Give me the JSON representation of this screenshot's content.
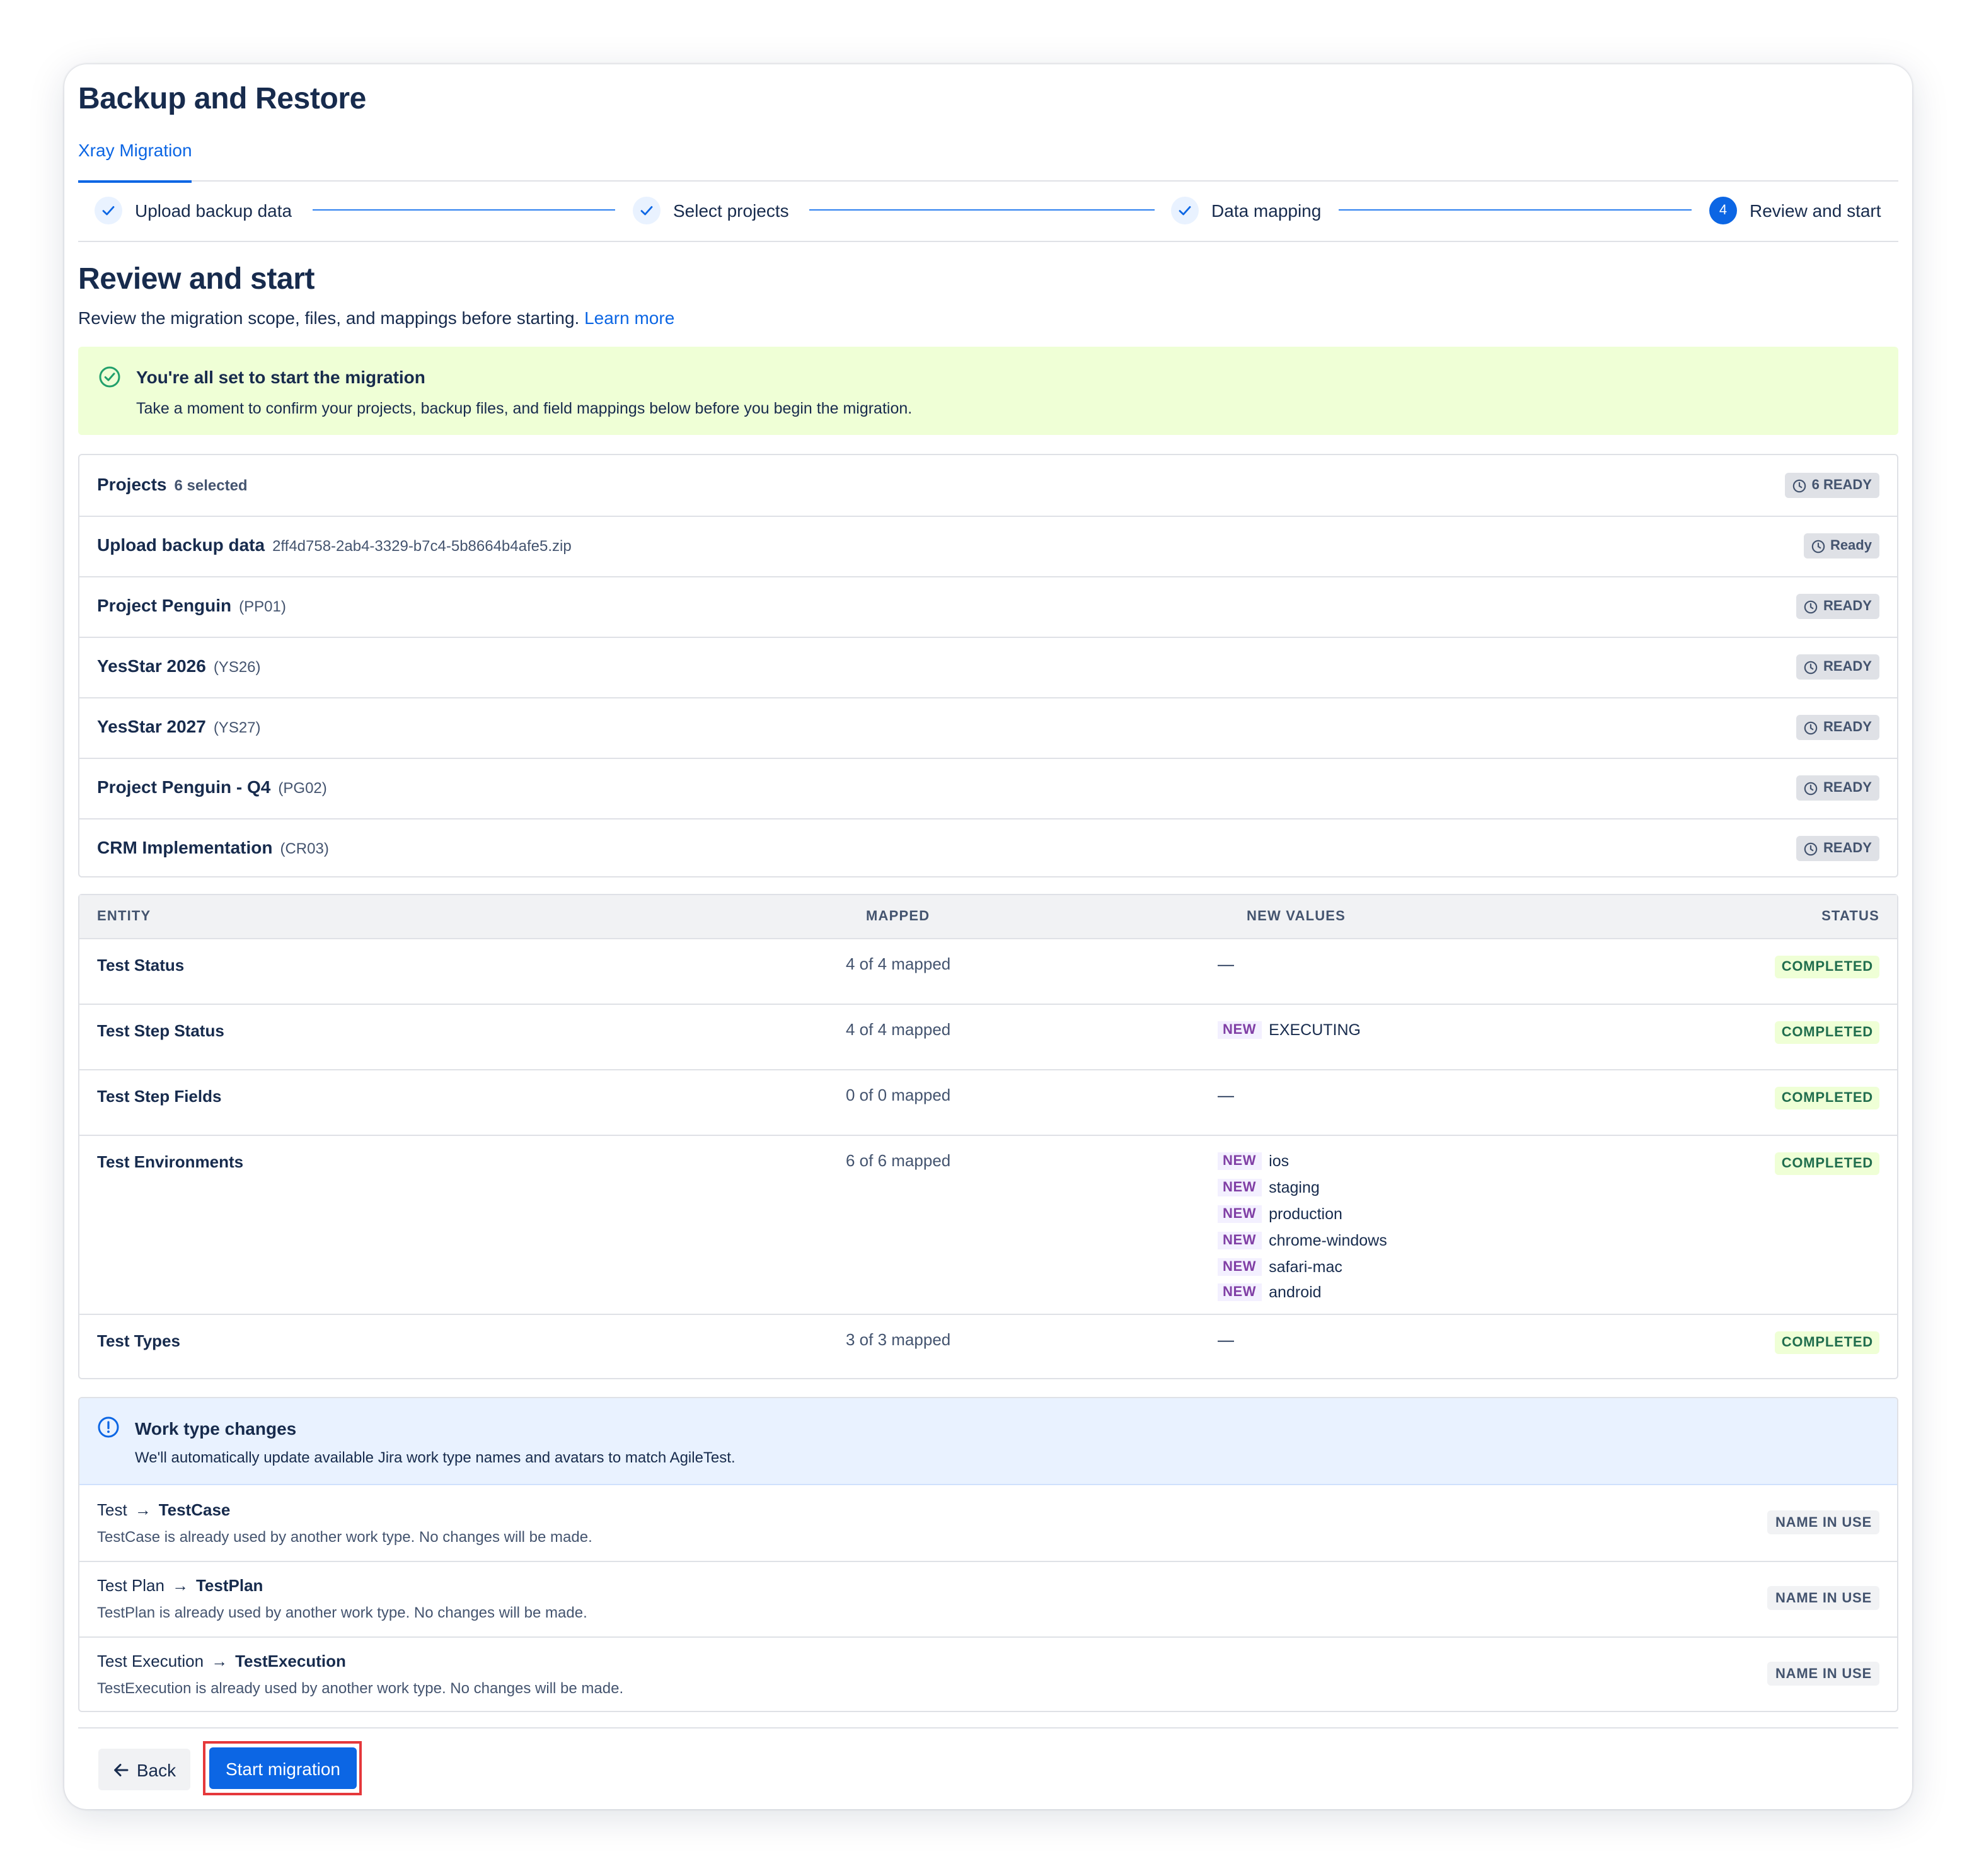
{
  "page": {
    "title": "Backup and Restore",
    "tab": "Xray Migration"
  },
  "stepper": {
    "steps": [
      {
        "label": "Upload backup data",
        "state": "done",
        "icon": "check-icon"
      },
      {
        "label": "Select projects",
        "state": "done",
        "icon": "check-icon"
      },
      {
        "label": "Data mapping",
        "state": "done",
        "icon": "check-icon"
      },
      {
        "label": "Review and start",
        "state": "current",
        "number": "4"
      }
    ]
  },
  "review": {
    "heading": "Review and start",
    "subtitle": "Review the migration scope, files, and mappings before starting.",
    "learn_more": "Learn more"
  },
  "success_banner": {
    "icon": "check-circle-icon",
    "title": "You're all set to start the migration",
    "description": "Take a moment to confirm your projects, backup files, and field mappings below before you begin the migration."
  },
  "projects_panel": {
    "title": "Projects",
    "selected": "6 selected",
    "ready_badge": "6 READY",
    "backup": {
      "label": "Upload backup data",
      "file": "2ff4d758-2ab4-3329-b7c4-5b8664b4afe5.zip",
      "status": "Ready"
    },
    "projects": [
      {
        "name": "Project Penguin",
        "key": "(PP01)",
        "status": "READY"
      },
      {
        "name": "YesStar 2026",
        "key": "(YS26)",
        "status": "READY"
      },
      {
        "name": "YesStar 2027",
        "key": "(YS27)",
        "status": "READY"
      },
      {
        "name": "Project Penguin - Q4",
        "key": "(PG02)",
        "status": "READY"
      },
      {
        "name": "CRM Implementation",
        "key": "(CR03)",
        "status": "READY"
      }
    ]
  },
  "mapping_table": {
    "columns": [
      "ENTITY",
      "MAPPED",
      "NEW VALUES",
      "STATUS"
    ],
    "new_tag": "NEW",
    "empty_value": "—",
    "rows": [
      {
        "entity": "Test Status",
        "mapped": "4 of 4 mapped",
        "new_values": [],
        "status": "COMPLETED"
      },
      {
        "entity": "Test Step Status",
        "mapped": "4 of 4 mapped",
        "new_values": [
          "EXECUTING"
        ],
        "status": "COMPLETED"
      },
      {
        "entity": "Test Step Fields",
        "mapped": "0 of 0 mapped",
        "new_values": [],
        "status": "COMPLETED"
      },
      {
        "entity": "Test Environments",
        "mapped": "6 of 6 mapped",
        "new_values": [
          "ios",
          "staging",
          "production",
          "chrome-windows",
          "safari-mac",
          "android"
        ],
        "status": "COMPLETED"
      },
      {
        "entity": "Test Types",
        "mapped": "3 of 3 mapped",
        "new_values": [],
        "status": "COMPLETED"
      }
    ]
  },
  "work_type": {
    "icon": "info-icon",
    "title": "Work type changes",
    "description": "We'll automatically update available Jira work type names and avatars to match AgileTest.",
    "items": [
      {
        "from": "Test",
        "to": "TestCase",
        "note": "TestCase is already used by another work type. No changes will be made.",
        "status": "NAME IN USE"
      },
      {
        "from": "Test Plan",
        "to": "TestPlan",
        "note": "TestPlan is already used by another work type. No changes will be made.",
        "status": "NAME IN USE"
      },
      {
        "from": "Test Execution",
        "to": "TestExecution",
        "note": "TestExecution is already used by another work type. No changes will be made.",
        "status": "NAME IN USE"
      }
    ]
  },
  "actions": {
    "back": "Back",
    "start": "Start migration"
  },
  "colors": {
    "accent": "#0c66e4",
    "success_bg": "#efffd6",
    "success_text": "#216e4e",
    "new_tag": "#803fa5",
    "highlight": "#e5383b"
  }
}
